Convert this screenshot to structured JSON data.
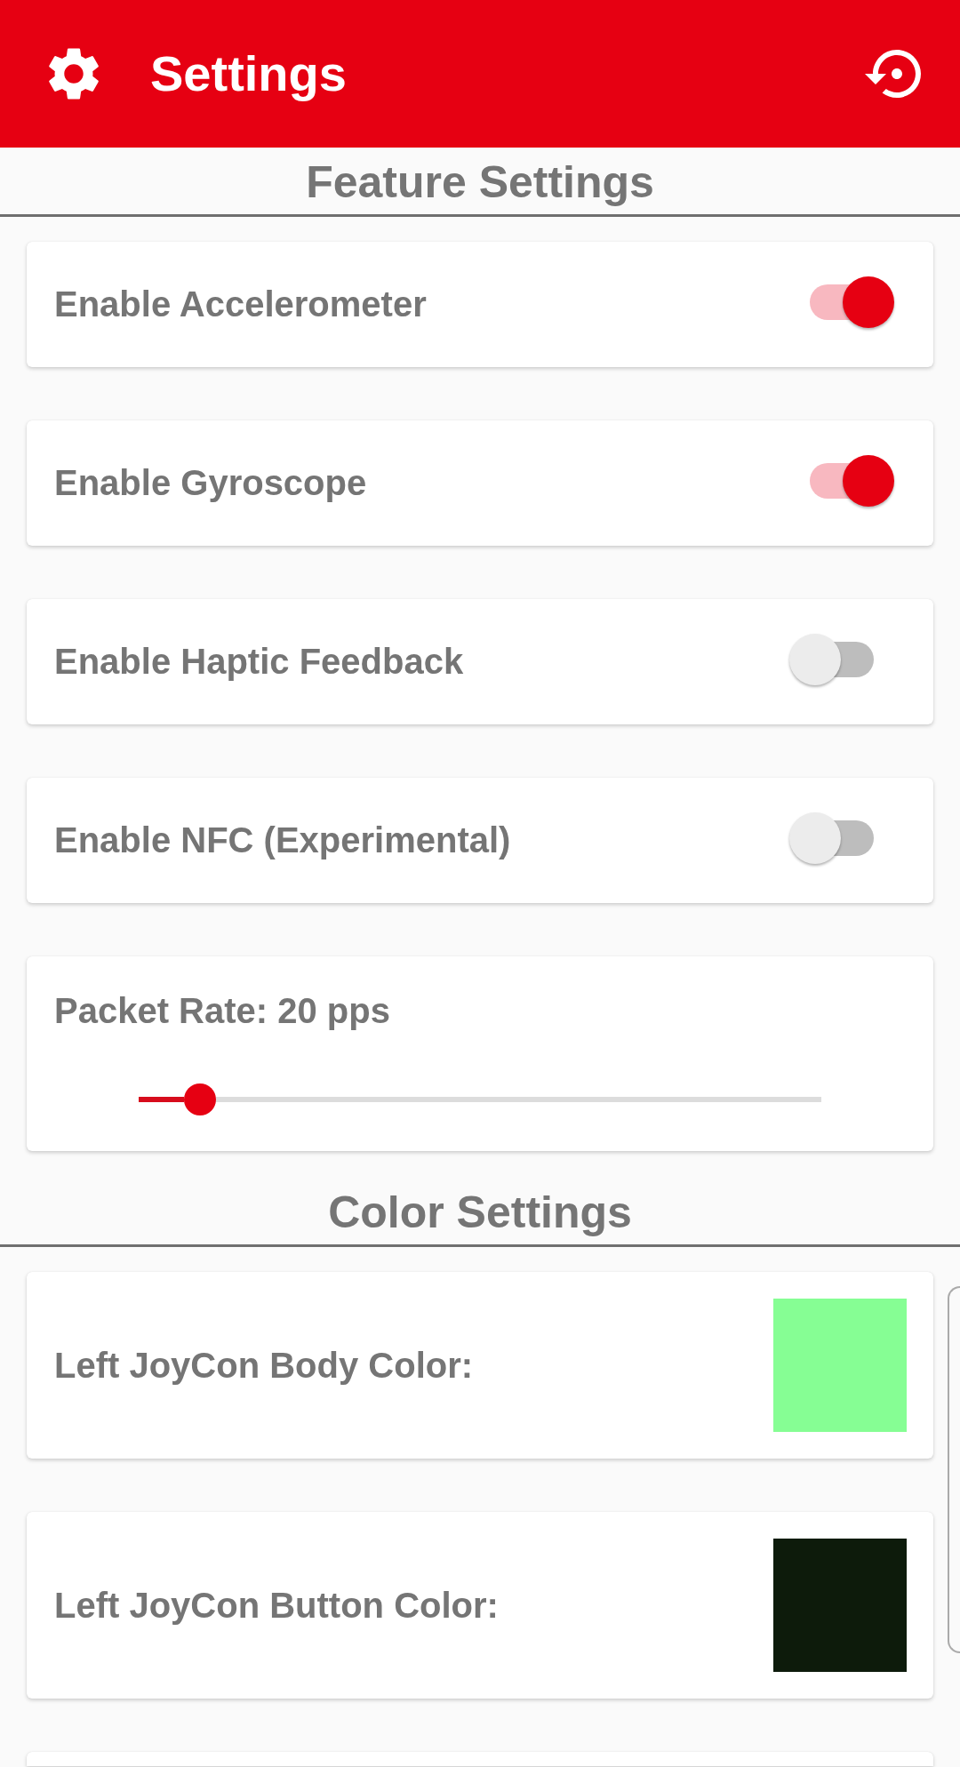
{
  "app_bar": {
    "title": "Settings"
  },
  "sections": [
    {
      "title": "Feature Settings",
      "items": [
        {
          "kind": "switch",
          "label": "Enable Accelerometer",
          "on": true
        },
        {
          "kind": "switch",
          "label": "Enable Gyroscope",
          "on": true
        },
        {
          "kind": "switch",
          "label": "Enable Haptic Feedback",
          "on": false
        },
        {
          "kind": "switch",
          "label": "Enable NFC (Experimental)",
          "on": false
        },
        {
          "kind": "slider",
          "label": "Packet Rate: 20 pps",
          "level": 0.09
        }
      ]
    },
    {
      "title": "Color Settings",
      "items": [
        {
          "kind": "color",
          "label": "Left JoyCon Body Color:",
          "color": "#86fe94"
        },
        {
          "kind": "color",
          "label": "Left JoyCon Button Color:",
          "color": "#0d1b0b"
        }
      ],
      "more_below": true
    }
  ]
}
